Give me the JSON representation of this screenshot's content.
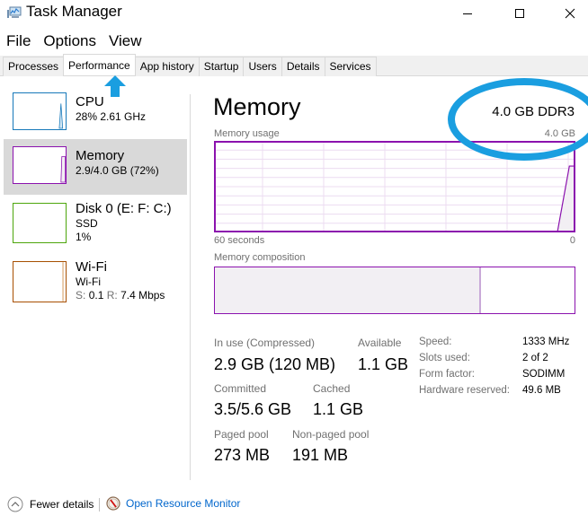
{
  "window": {
    "title": "Task Manager",
    "icons": {
      "app": "task-manager-icon",
      "minimize": "minimize-icon",
      "maximize": "maximize-icon",
      "close": "close-icon"
    }
  },
  "menu": {
    "items": [
      "File",
      "Options",
      "View"
    ]
  },
  "tabs": {
    "items": [
      "Processes",
      "Performance",
      "App history",
      "Startup",
      "Users",
      "Details",
      "Services"
    ],
    "active": "Performance"
  },
  "sidebar": {
    "items": [
      {
        "title": "CPU",
        "sub1": "28% 2.61 GHz",
        "color": "#1779ba"
      },
      {
        "title": "Memory",
        "sub1": "2.9/4.0 GB (72%)",
        "color": "#8b12ae"
      },
      {
        "title": "Disk 0 (E: F: C:)",
        "sub1": "SSD",
        "sub2": "1%",
        "color": "#4da60c"
      },
      {
        "title": "Wi-Fi",
        "sub1": "Wi-Fi",
        "sub2_s_label": "S:",
        "sub2_s_value": "0.1",
        "sub2_r_label": "R:",
        "sub2_r_value": "7.4 Mbps",
        "color": "#a74f01"
      }
    ],
    "selected": "Memory"
  },
  "main": {
    "title": "Memory",
    "spec": "4.0 GB DDR3",
    "usage_label": "Memory usage",
    "usage_max": "4.0 GB",
    "time_left": "60 seconds",
    "time_right": "0",
    "composition_label": "Memory composition",
    "composition_in_use_fraction": 0.74,
    "accent": "#8b12ae",
    "stats": {
      "in_use_label": "In use (Compressed)",
      "in_use_value": "2.9 GB (120 MB)",
      "available_label": "Available",
      "available_value": "1.1 GB",
      "committed_label": "Committed",
      "committed_value": "3.5/5.6 GB",
      "cached_label": "Cached",
      "cached_value": "1.1 GB",
      "paged_label": "Paged pool",
      "paged_value": "273 MB",
      "nonpaged_label": "Non-paged pool",
      "nonpaged_value": "191 MB"
    },
    "specs": [
      {
        "label": "Speed:",
        "value": "1333 MHz"
      },
      {
        "label": "Slots used:",
        "value": "2 of 2"
      },
      {
        "label": "Form factor:",
        "value": "SODIMM"
      },
      {
        "label": "Hardware reserved:",
        "value": "49.6 MB"
      }
    ]
  },
  "chart_data": {
    "type": "area",
    "title": "Memory usage",
    "xlabel_left": "60 seconds",
    "xlabel_right": "0",
    "ymax_label": "4.0 GB",
    "ylim": [
      0,
      4.0
    ],
    "x": [
      60,
      3,
      1,
      0
    ],
    "values": [
      0,
      0,
      2.9,
      2.9
    ],
    "grid": true
  },
  "annotations": {
    "arrow_target": "Performance",
    "circle_target": "4.0 GB DDR3",
    "color": "#1a9ee0"
  },
  "footer": {
    "fewer_details": "Fewer details",
    "resource_monitor": "Open Resource Monitor"
  }
}
